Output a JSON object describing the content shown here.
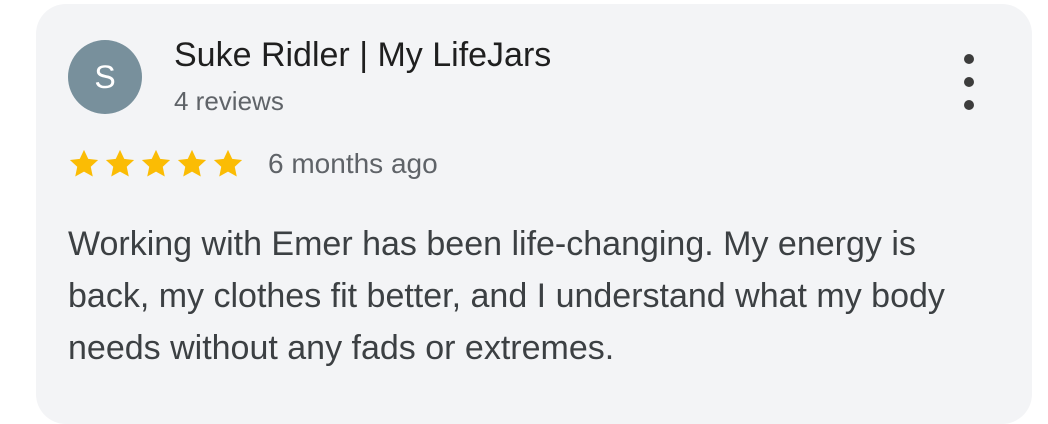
{
  "review": {
    "avatar_letter": "S",
    "avatar_color": "#78909c",
    "author_name": "Suke Ridler | My LifeJars",
    "review_count": "4 reviews",
    "rating": 5,
    "rating_max": 5,
    "star_color": "#fbbc04",
    "time_ago": "6 months ago",
    "text": "Working with Emer has been life-changing. My energy is back, my clothes fit better, and I understand what my body needs without any fads or extremes.",
    "menu_icon": "more-vert-icon"
  }
}
